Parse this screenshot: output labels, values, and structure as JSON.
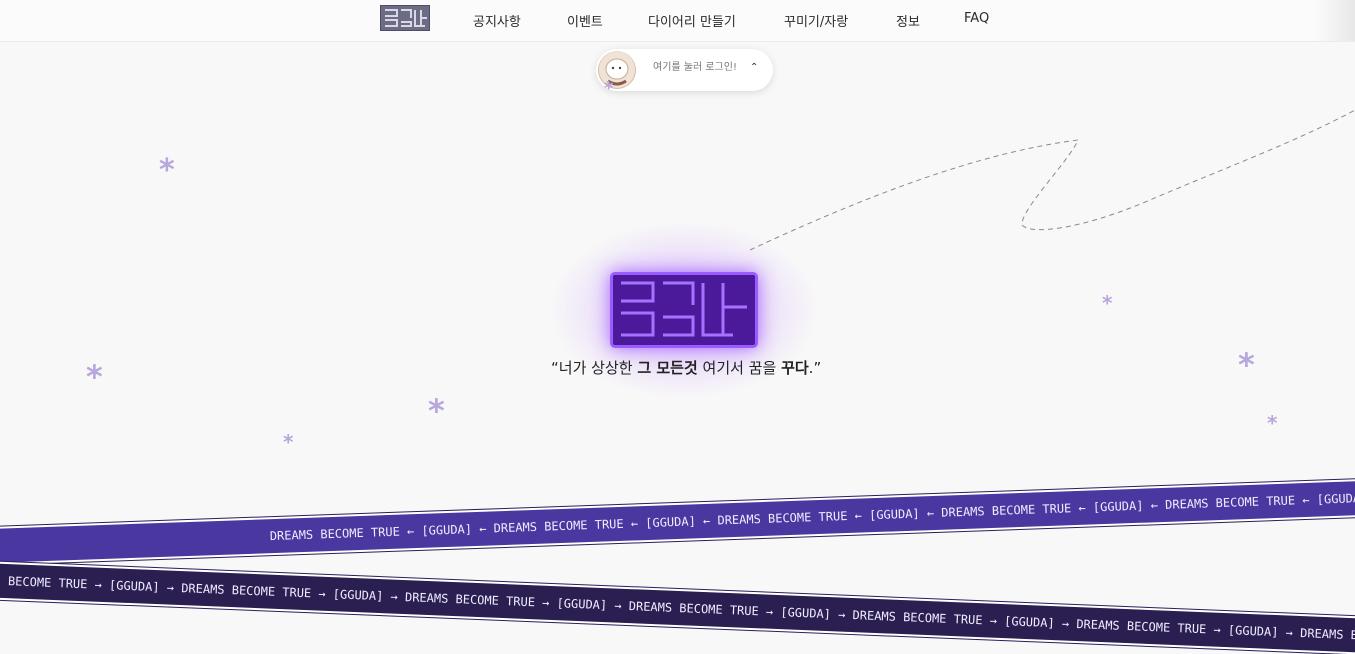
{
  "nav": {
    "items": [
      {
        "label": "공지사항"
      },
      {
        "label": "이벤트"
      },
      {
        "label": "다이어리 만들기"
      },
      {
        "label": "꾸미기/자랑"
      },
      {
        "label": "정보"
      },
      {
        "label": "FAQ"
      }
    ]
  },
  "login": {
    "text": "여기를 눌러 로그인!",
    "chevron": "⌃"
  },
  "hero": {
    "slogan_open": "“너가 상상한 ",
    "slogan_bold1": "그 모든것",
    "slogan_mid": " 여기서 꿈을 ",
    "slogan_bold2": "꾸다",
    "slogan_close": ".”"
  },
  "ribbons": {
    "back_text": "DREAMS BECOME TRUE ← [GGUDA] ← DREAMS BECOME TRUE ← [GGUDA] ← DREAMS BECOME TRUE ← [GGUDA] ← DREAMS BECOME TRUE ← [GGUDA] ← DREAMS BECOME TRUE ← [GGUDA] ← DREAMS BECOME TRUE",
    "front_text": "BECOME TRUE → [GGUDA] → DREAMS BECOME TRUE → [GGUDA] → DREAMS BECOME TRUE → [GGUDA] → DREAMS BECOME TRUE → [GGUDA] → DREAMS BECOME TRUE → [GGUDA] → DREAMS BECOME TRUE → [GGUDA] → DREAMS BECOME TRUE → [GGU"
  },
  "colors": {
    "accent": "#4a1a9a",
    "glow": "#9b5cff",
    "star": "#b8a6de",
    "ribbon_back": "#4b37a0",
    "ribbon_front": "#2b1f52"
  }
}
